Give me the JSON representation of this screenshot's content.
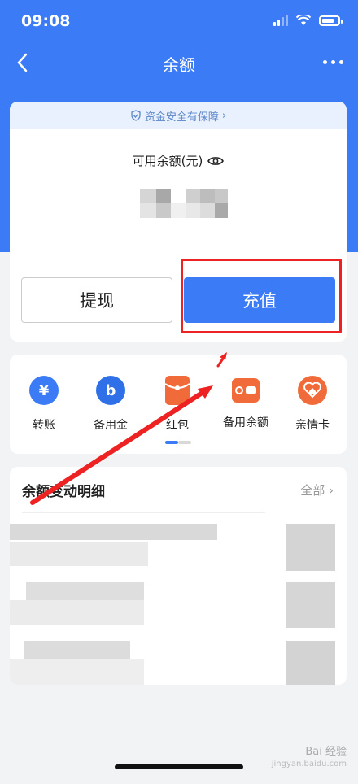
{
  "status_bar": {
    "time": "09:08"
  },
  "nav": {
    "title": "余额"
  },
  "balance": {
    "safety_text": "资金安全有保障",
    "available_label": "可用余额(元)",
    "withdraw_label": "提现",
    "topup_label": "充值"
  },
  "services": [
    {
      "label": "转账",
      "icon": "transfer-icon",
      "color": "#3b7bf6"
    },
    {
      "label": "备用金",
      "icon": "reserve-fund-icon",
      "color": "#2f6fe8"
    },
    {
      "label": "红包",
      "icon": "red-packet-icon",
      "color": "#f06a3a"
    },
    {
      "label": "备用余额",
      "icon": "wallet-icon",
      "color": "#f06a3a"
    },
    {
      "label": "亲情卡",
      "icon": "family-card-icon",
      "color": "#f06a3a"
    }
  ],
  "records": {
    "title": "余额变动明细",
    "all_label": "全部"
  },
  "watermark": {
    "text": "Bai 经验",
    "url": "jingyan.baidu.com"
  }
}
